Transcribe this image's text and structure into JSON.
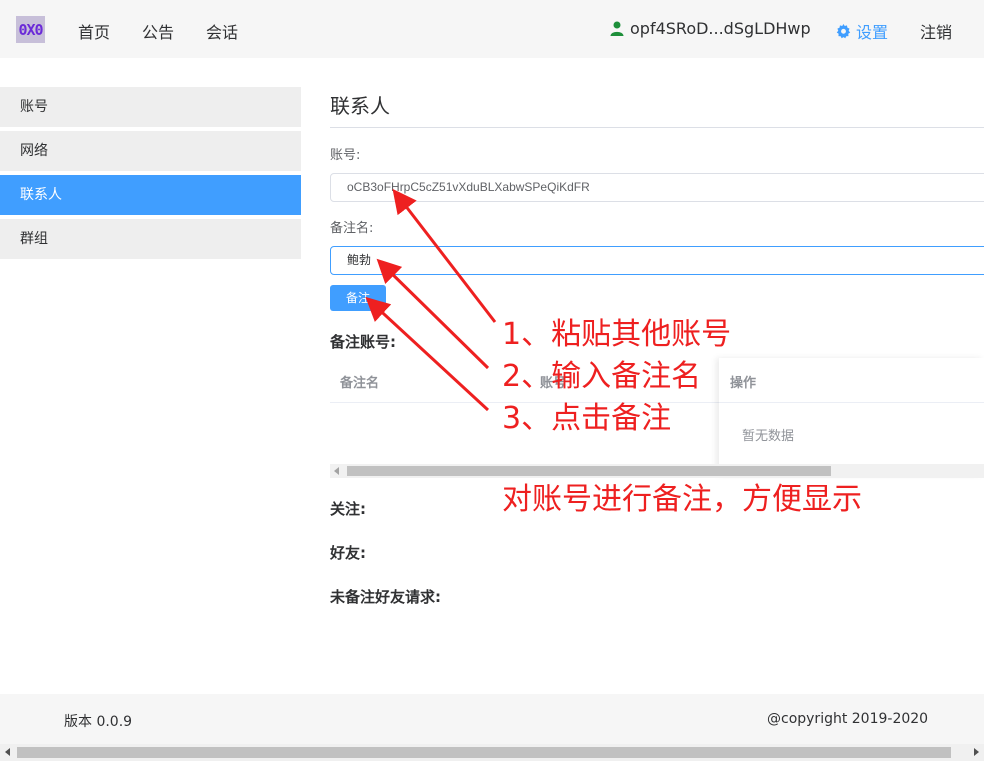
{
  "header": {
    "logo_text": "0X0",
    "nav": [
      "首页",
      "公告",
      "会话"
    ],
    "username": "opf4SRoD...dSgLDHwp",
    "settings_label": "设置",
    "logout_label": "注销",
    "accent_color": "#409eff"
  },
  "sidebar": {
    "items": [
      {
        "label": "账号",
        "active": false
      },
      {
        "label": "网络",
        "active": false
      },
      {
        "label": "联系人",
        "active": true
      },
      {
        "label": "群组",
        "active": false
      }
    ]
  },
  "main": {
    "title": "联系人",
    "account_label": "账号:",
    "account_value": "oCB3oFHrpC5cZ51vXduBLXabwSPeQiKdFR",
    "remark_label": "备注名:",
    "remark_value": "鲍勃",
    "remark_button": "备注",
    "remarked_accounts_heading": "备注账号:",
    "table": {
      "columns": [
        "备注名",
        "账号",
        "操作"
      ],
      "empty_text": "暂无数据"
    },
    "follow_heading": "关注:",
    "friends_heading": "好友:",
    "pending_heading": "未备注好友请求:"
  },
  "annotations": {
    "step1": "1、粘贴其他账号",
    "step2": "2、输入备注名",
    "step3": "3、点击备注",
    "summary": "对账号进行备注，方便显示",
    "color": "#ee2020"
  },
  "footer": {
    "version": "版本 0.0.9",
    "copyright": "@copyright 2019-2020"
  }
}
